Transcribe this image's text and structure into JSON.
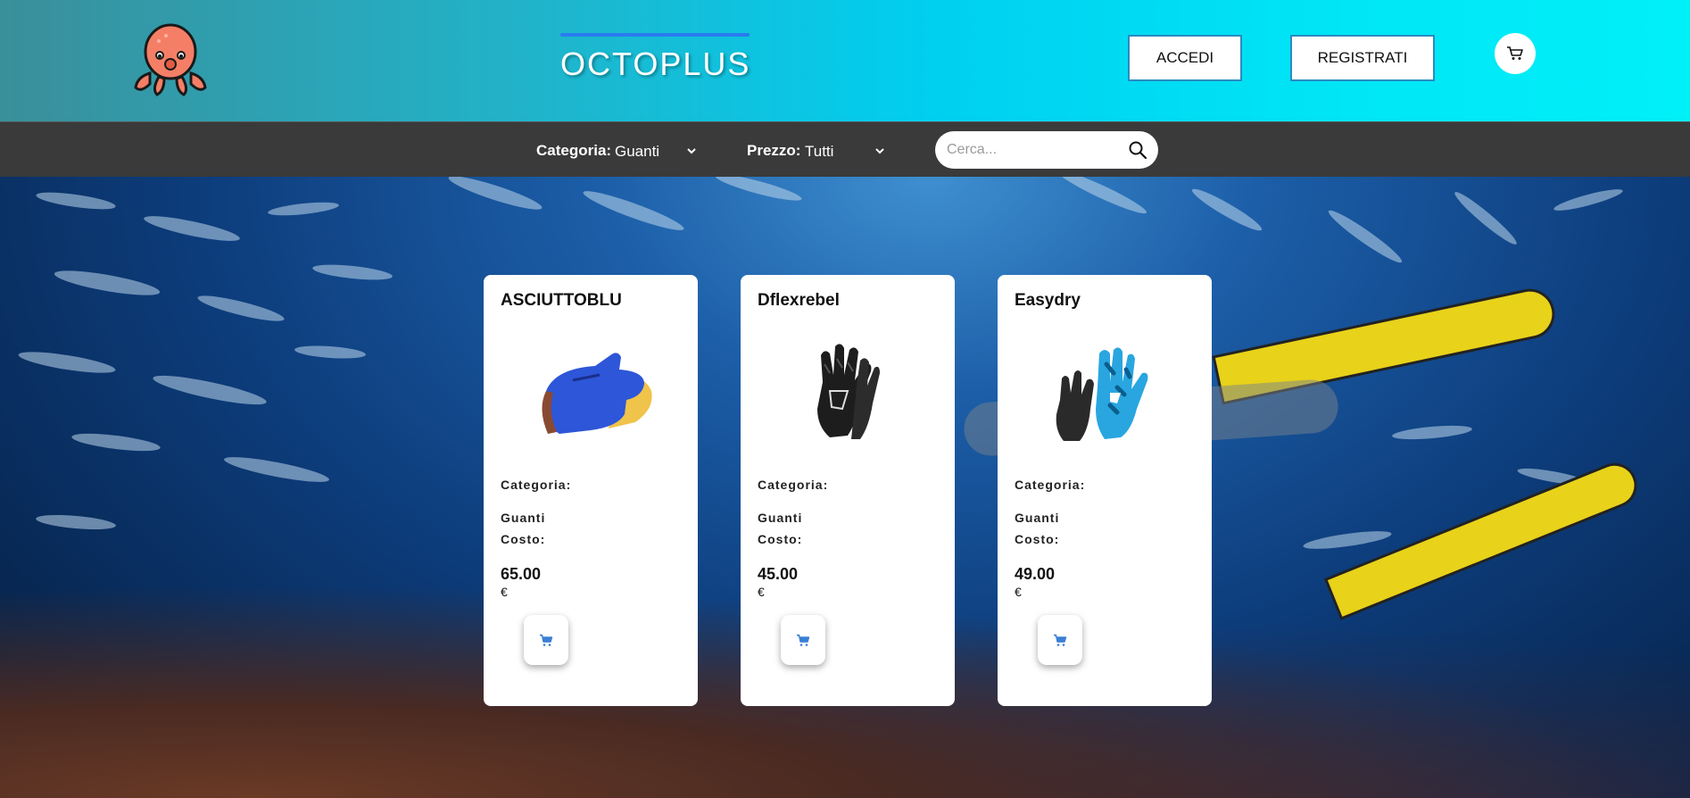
{
  "header": {
    "brand": "OCTOPLUS",
    "login_label": "ACCEDI",
    "register_label": "REGISTRATI",
    "logo_icon": "octopus-logo",
    "cart_icon": "cart-icon"
  },
  "filters": {
    "category_label": "Categoria:",
    "category_value": "Guanti",
    "price_label": "Prezzo:",
    "price_value": "Tutti",
    "search_placeholder": "Cerca..."
  },
  "products": [
    {
      "name": "ASCIUTTOBLU",
      "category_label": "Categoria:",
      "category": "Guanti",
      "cost_label": "Costo:",
      "price": "65.00",
      "currency": "€",
      "image_icon": "blue-dry-glove-image"
    },
    {
      "name": "Dflexrebel",
      "category_label": "Categoria:",
      "category": "Guanti",
      "cost_label": "Costo:",
      "price": "45.00",
      "currency": "€",
      "image_icon": "black-neoprene-glove-image"
    },
    {
      "name": "Easydry",
      "category_label": "Categoria:",
      "category": "Guanti",
      "cost_label": "Costo:",
      "price": "49.00",
      "currency": "€",
      "image_icon": "blue-camo-glove-image"
    }
  ],
  "colors": {
    "header_gradient_start": "#3a8f9a",
    "header_gradient_end": "#00f0f8",
    "filterbar": "#3a3a3a",
    "brand_underline": "#2a7bf0",
    "cart_button_icon": "#3a7fd5"
  }
}
